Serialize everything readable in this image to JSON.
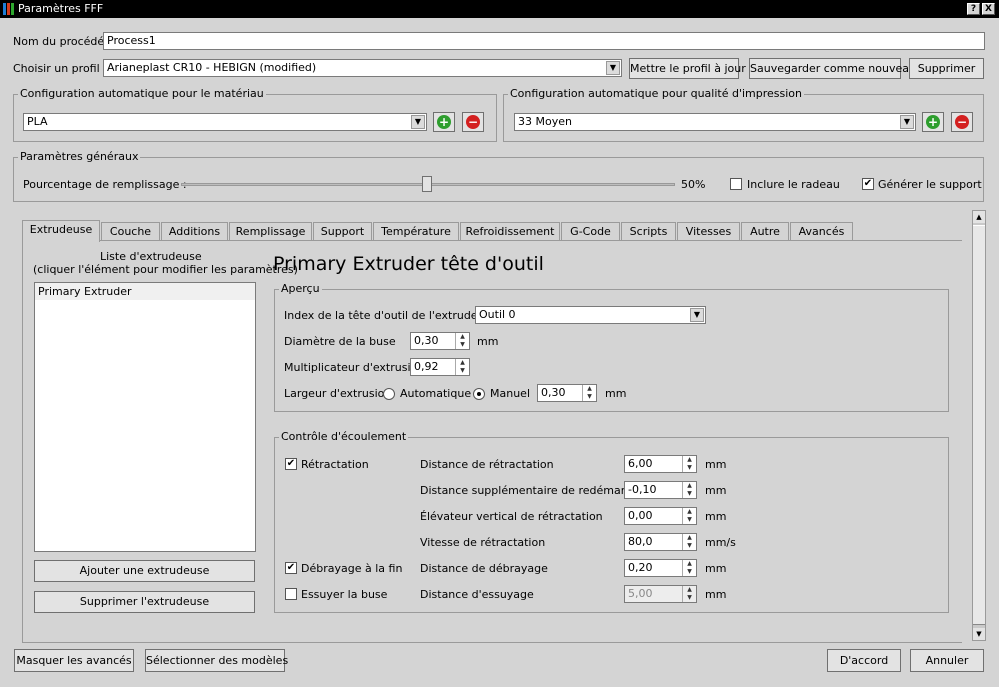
{
  "window": {
    "title": "Paramètres FFF",
    "help_btn": "?",
    "close_btn": "X"
  },
  "process": {
    "label": "Nom du procédé :",
    "value": "Process1"
  },
  "profile": {
    "label": "Choisir un profil :",
    "value": "Arianeplast CR10 - HEBIGN (modified)",
    "update": "Mettre le profil à jour",
    "save_new": "Sauvegarder comme nouveau",
    "delete": "Supprimer"
  },
  "material": {
    "group": "Configuration automatique pour le matériau",
    "value": "PLA"
  },
  "quality": {
    "group": "Configuration automatique pour qualité d'impression",
    "value": "33 Moyen"
  },
  "general": {
    "group": "Paramètres généraux",
    "infill_label": "Pourcentage de remplissage :",
    "infill_value": "50%",
    "infill_fraction": 0.5,
    "raft_label": "Inclure le radeau",
    "raft_checked": false,
    "support_label": "Générer le support",
    "support_checked": true
  },
  "tabs": [
    "Extrudeuse",
    "Couche",
    "Additions",
    "Remplissage",
    "Support",
    "Température",
    "Refroidissement",
    "G-Code",
    "Scripts",
    "Vitesses",
    "Autre",
    "Avancés"
  ],
  "extruder_list": {
    "title_line1": "Liste d'extrudeuse",
    "title_line2": "(cliquer l'élément pour modifier les paramètres)",
    "items": [
      "Primary Extruder"
    ],
    "add": "Ajouter une extrudeuse",
    "remove": "Supprimer l'extrudeuse"
  },
  "heading": "Primary Extruder tête d'outil",
  "overview": {
    "group": "Aperçu",
    "tool_index_label": "Index de la tête d'outil de l'extrudeuse",
    "tool_index_value": "Outil 0",
    "nozzle_label": "Diamètre de la buse",
    "nozzle_value": "0,30",
    "nozzle_unit": "mm",
    "mult_label": "Multiplicateur d'extrusion",
    "mult_value": "0,92",
    "width_label": "Largeur d'extrusion",
    "width_auto": "Automatique",
    "width_manual": "Manuel",
    "width_value": "0,30",
    "width_unit": "mm"
  },
  "flow": {
    "group": "Contrôle d'écoulement",
    "retraction_label": "Rétractation",
    "retraction_checked": true,
    "coast_label": "Débrayage à la fin",
    "coast_checked": true,
    "wipe_label": "Essuyer la buse",
    "wipe_checked": false,
    "rows": [
      {
        "label": "Distance de rétractation",
        "value": "6,00",
        "unit": "mm"
      },
      {
        "label": "Distance supplémentaire de redémarrage",
        "value": "-0,10",
        "unit": "mm"
      },
      {
        "label": "Élévateur vertical de rétractation",
        "value": "0,00",
        "unit": "mm"
      },
      {
        "label": "Vitesse de rétractation",
        "value": "80,0",
        "unit": "mm/s"
      },
      {
        "label": "Distance de débrayage",
        "value": "0,20",
        "unit": "mm"
      },
      {
        "label": "Distance d'essuyage",
        "value": "5,00",
        "unit": "mm"
      }
    ]
  },
  "footer": {
    "hide_advanced": "Masquer les avancés",
    "select_models": "Sélectionner des modèles",
    "ok": "D'accord",
    "cancel": "Annuler"
  },
  "icons": {
    "check": "✔",
    "plus": "+",
    "minus": "−",
    "arrow_down": "▼",
    "arrow_up": "▲"
  },
  "colors": {
    "add_green": "#2e9e2e",
    "remove_red": "#d42020",
    "titlebar": "#000000"
  }
}
